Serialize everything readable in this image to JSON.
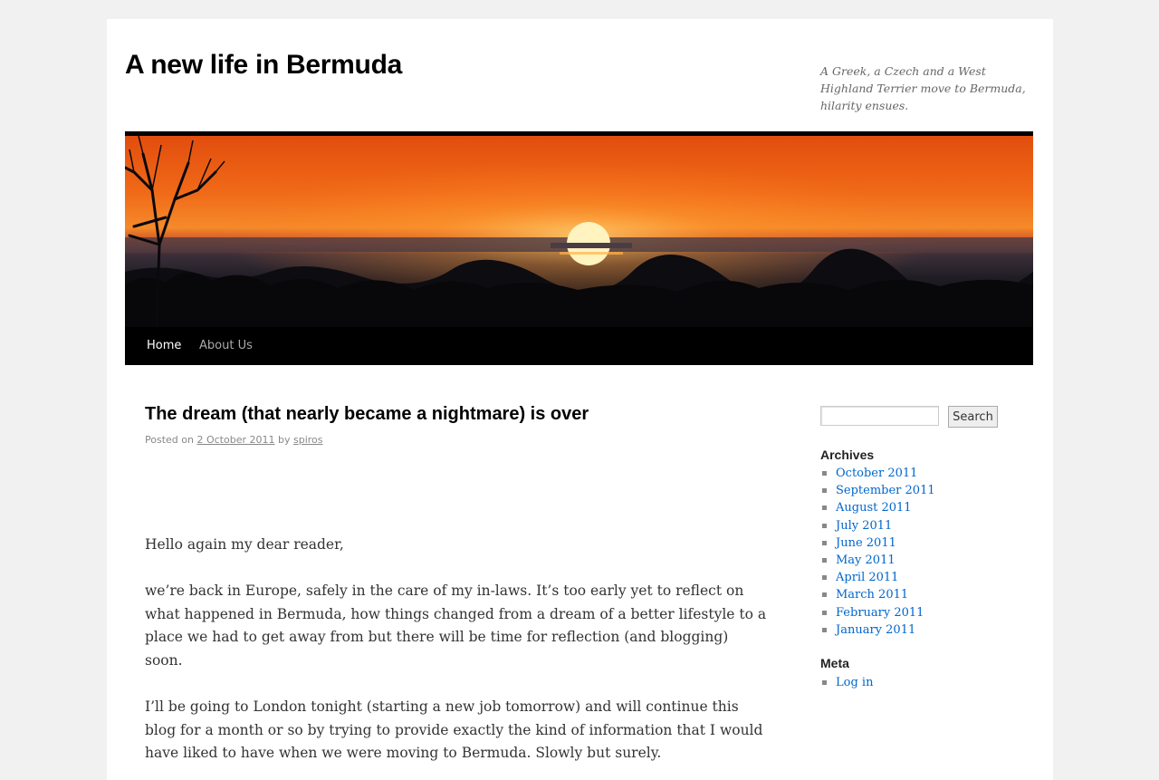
{
  "site": {
    "title": "A new life in Bermuda",
    "description": "A Greek, a Czech and a West Highland Terrier move to Bermuda, hilarity ensues."
  },
  "nav": {
    "items": [
      {
        "label": "Home",
        "current": true
      },
      {
        "label": "About Us",
        "current": false
      }
    ]
  },
  "post": {
    "title": "The dream (that nearly became a nightmare) is over",
    "meta": {
      "posted_on": "Posted on",
      "date": "2 October 2011",
      "by": "by",
      "author": "spiros"
    },
    "paragraphs": [
      "Hello again my dear reader,",
      "we’re back in Europe, safely in the care of my in-laws. It’s too early yet to reflect on what happened in Bermuda, how things changed from a dream of a better lifestyle to a place we had to get away from but there will be time for reflection (and blogging) soon.",
      "I’ll be going to London tonight (starting a new job tomorrow) and will continue this blog for a month or so by trying to provide exactly the kind of information that I would have liked to have when we were moving to Bermuda. Slowly but surely."
    ]
  },
  "sidebar": {
    "search": {
      "button_label": "Search",
      "value": ""
    },
    "archives": {
      "title": "Archives",
      "items": [
        "October 2011",
        "September 2011",
        "August 2011",
        "July 2011",
        "June 2011",
        "May 2011",
        "April 2011",
        "March 2011",
        "February 2011",
        "January 2011"
      ]
    },
    "meta": {
      "title": "Meta",
      "items": [
        "Log in"
      ]
    }
  },
  "colors": {
    "link": "#0066cc",
    "nav_bar": "#000000",
    "page_bg": "#f1f1f1"
  }
}
